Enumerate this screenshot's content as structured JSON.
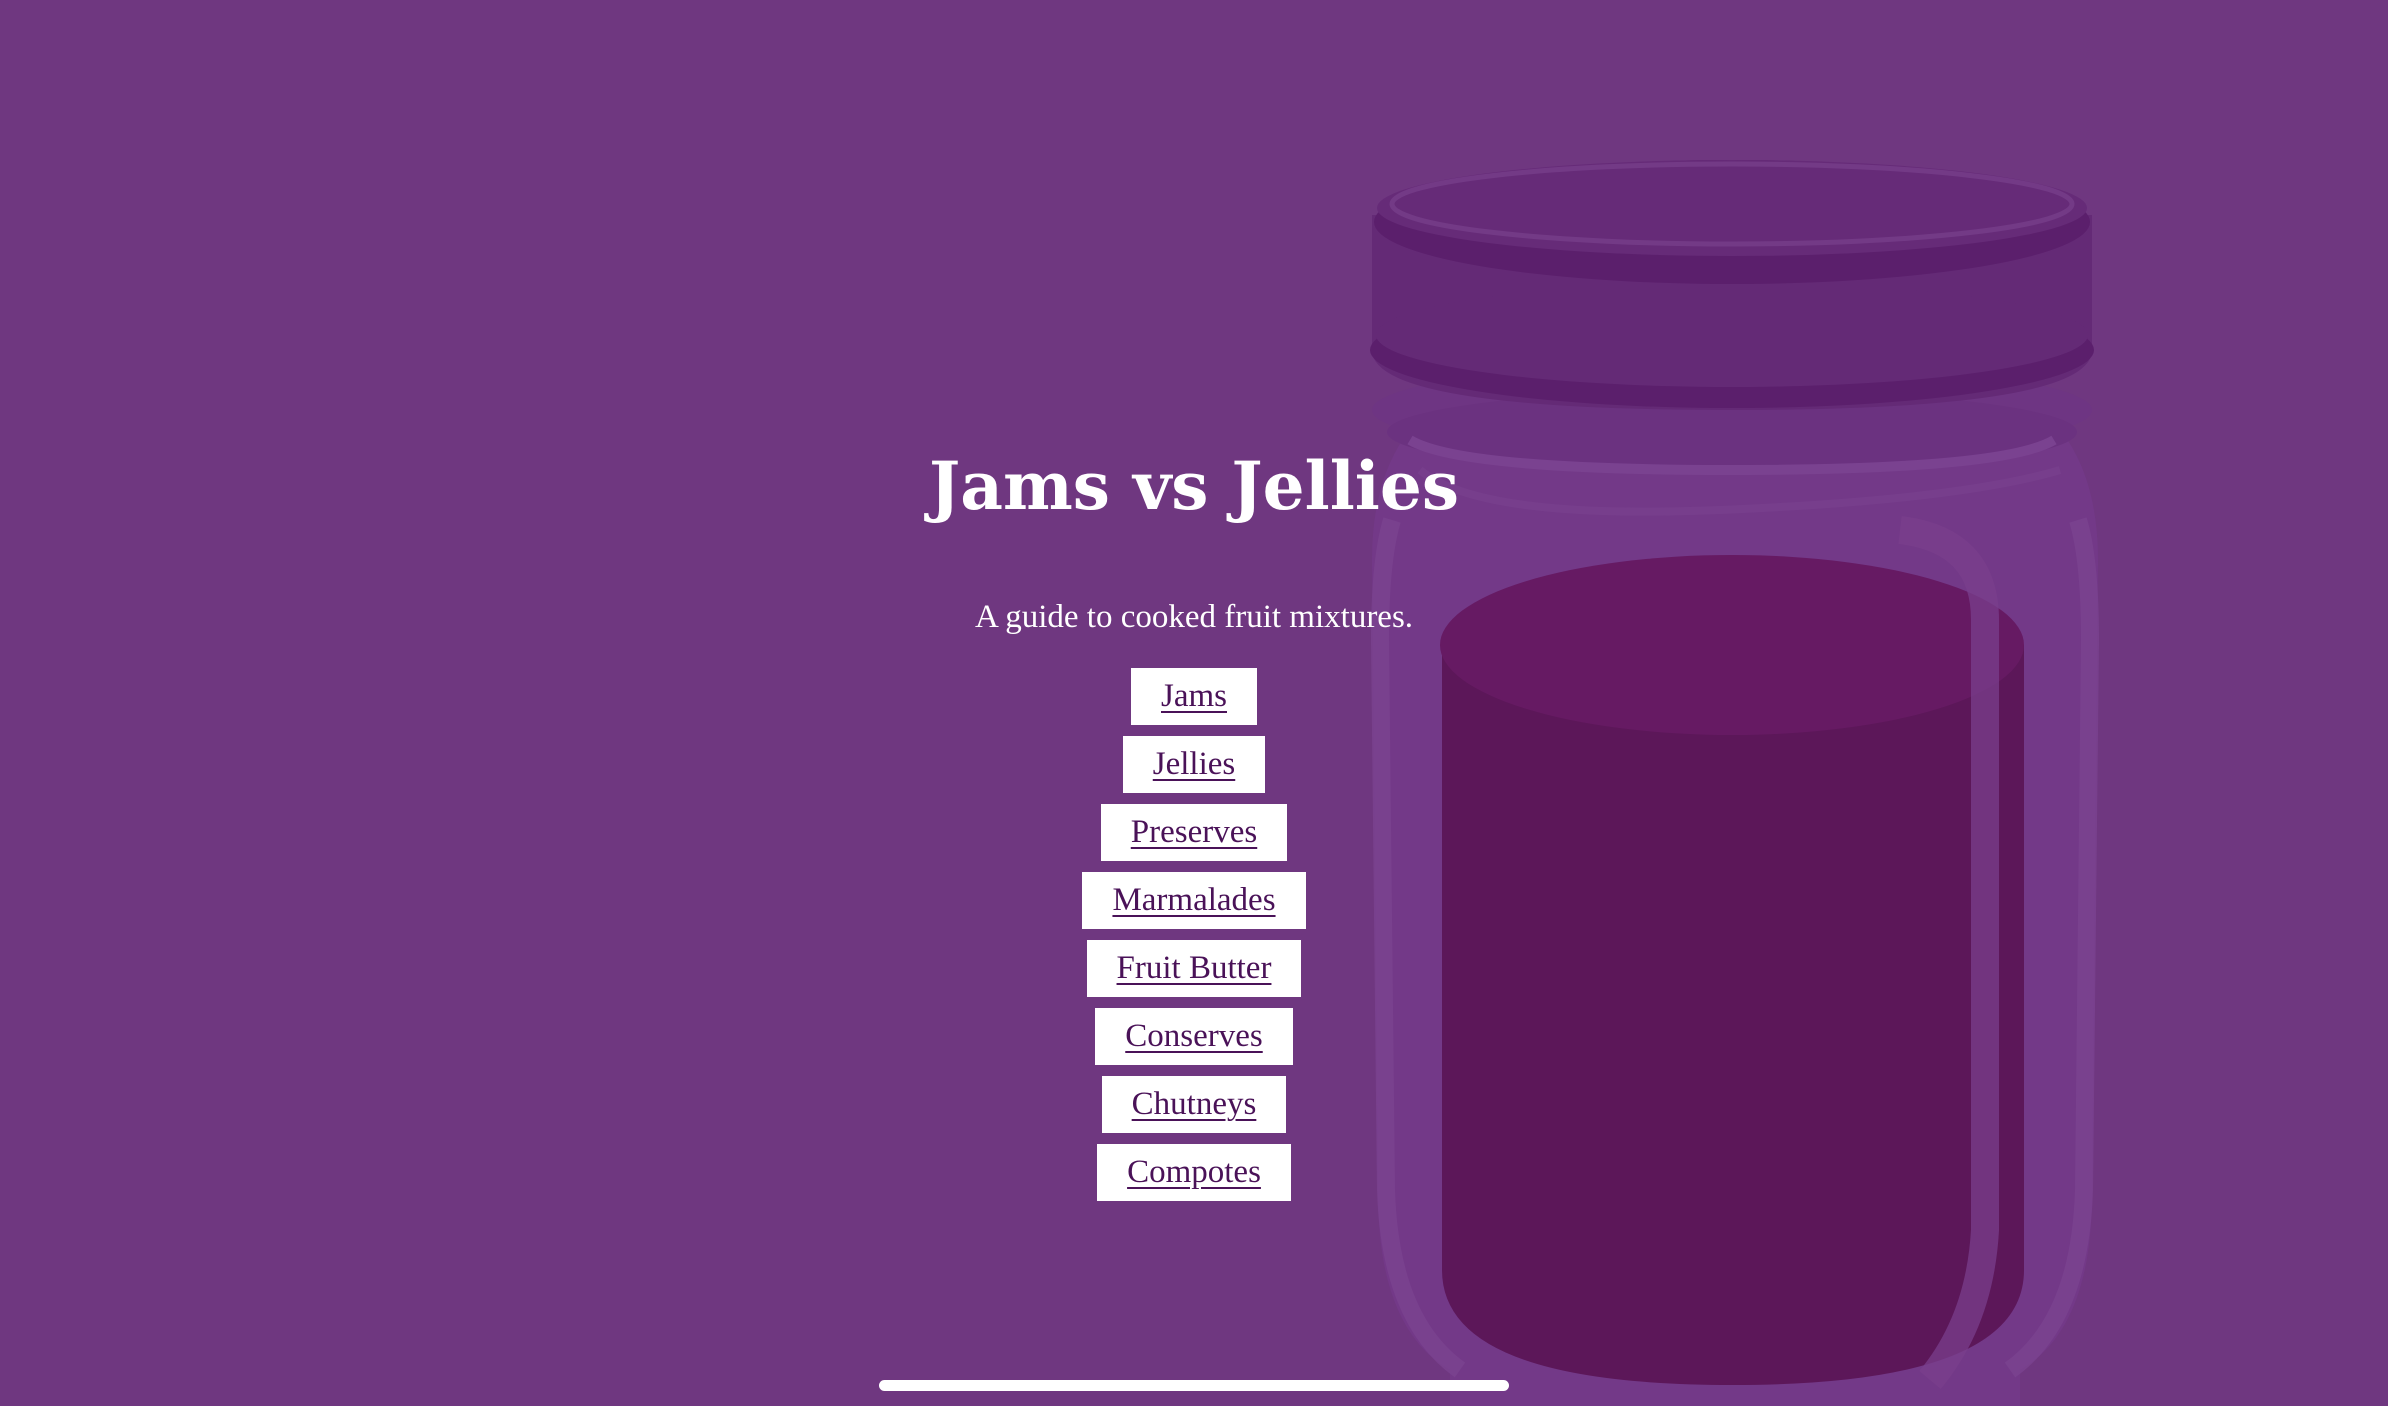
{
  "page": {
    "title": "Jams vs Jellies",
    "subtitle": "A guide to cooked fruit mixtures."
  },
  "nav": {
    "items": [
      {
        "label": "Jams"
      },
      {
        "label": "Jellies"
      },
      {
        "label": "Preserves"
      },
      {
        "label": "Marmalades"
      },
      {
        "label": "Fruit Butter"
      },
      {
        "label": "Conserves"
      },
      {
        "label": "Chutneys"
      },
      {
        "label": "Compotes"
      }
    ]
  },
  "colors": {
    "background": "#6f3780",
    "jam": "#5c1759",
    "link_text": "#4a1258",
    "button_bg": "#ffffff",
    "text": "#ffffff"
  },
  "illustration": {
    "icon": "jam-jar-icon"
  }
}
